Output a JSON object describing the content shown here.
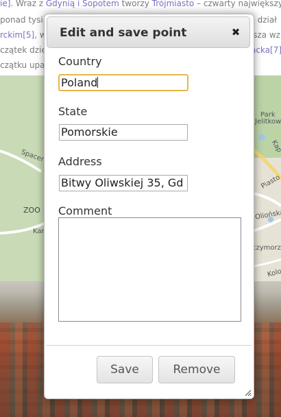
{
  "background": {
    "text_lines": [
      [
        "ie]",
        ". Wraz z ",
        "Gdynią i Sopotem",
        " tworzy ",
        "Trójmiasto",
        " – czwarty największy"
      ],
      [
        "ponad tysi",
        "",
        "",
        "",
        "",
        ", dział"
      ],
      [
        "rckim[5]",
        ", w",
        "",
        "",
        "",
        "ysza wz"
      ],
      [
        "czątek dzie",
        "",
        "",
        "",
        "acka[7]",
        ""
      ],
      [
        "czątku upa",
        "",
        "",
        "",
        "",
        ""
      ]
    ],
    "map_labels": {
      "park": "Park",
      "jelitkowski": "Jelitkowski",
      "spacer": "Spacer",
      "zoo": "ZOO",
      "kap": "Kap",
      "piast": "Piasto",
      "oliwska": "Oliońska",
      "czymorze": "czymorze",
      "kolob": "Kolob",
      "kar": "Kar"
    }
  },
  "dialog": {
    "title": "Edit and save point",
    "close_glyph": "✖",
    "fields": {
      "country": {
        "label": "Country",
        "value": "Poland"
      },
      "state": {
        "label": "State",
        "value": "Pomorskie"
      },
      "address": {
        "label": "Address",
        "value": "Bitwy Oliwskiej 35, Gd"
      },
      "comment": {
        "label": "Comment",
        "value": ""
      }
    },
    "buttons": {
      "save": "Save",
      "remove": "Remove"
    },
    "colors": {
      "focus_border": "#e6b64a",
      "header_gradient_top": "#f4f4f4",
      "header_gradient_bottom": "#dedede"
    }
  }
}
